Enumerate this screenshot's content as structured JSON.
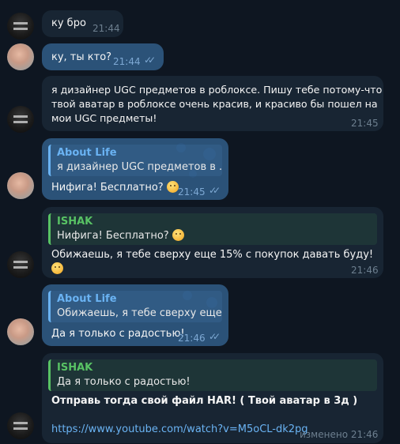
{
  "messages": [
    {
      "text": "ку бро",
      "time": "21:44"
    },
    {
      "text": "ку, ты кто?",
      "time": "21:44"
    },
    {
      "text": "я дизайнер UGC предметов в роблоксе. Пишу тебе потому-что\nтвой аватар в роблоксе очень красив, и красиво бы пошел на\nмои UGC предметы!",
      "time": "21:45"
    },
    {
      "reply_name": "About Life",
      "reply_text": "я дизайнер UGC предметов в ...",
      "text": "Нифига! Бесплатно?",
      "time": "21:45"
    },
    {
      "reply_name": "ISHAK",
      "reply_text": "Нифига! Бесплатно?",
      "text": "Обижаешь, я тебе сверху еще 15% с покупок давать буду!",
      "time": "21:46"
    },
    {
      "reply_name": "About Life",
      "reply_text": "Обижаешь, я тебе сверху еще...",
      "text": "Да я только с радостью!",
      "time": "21:46"
    },
    {
      "reply_name": "ISHAK",
      "reply_text": "Да я только с радостью!",
      "text": "Отправь тогда свой файл HAR! ( Твой аватар в 3д )",
      "link": "https://www.youtube.com/watch?v=M5oCL-dk2pg",
      "time": "изменено 21:46"
    }
  ],
  "icons": {
    "read_receipt": "double-check-icon",
    "emoji_flushed": "flushed-face-emoji",
    "emoji_smirk": "smirking-face-emoji"
  },
  "colors": {
    "background": "#0e1621",
    "incoming_bubble": "#182533",
    "outgoing_bubble": "#2b5278",
    "reply_blue": "#6ab3f3",
    "reply_green": "#58c264",
    "link": "#6ab3f3"
  }
}
